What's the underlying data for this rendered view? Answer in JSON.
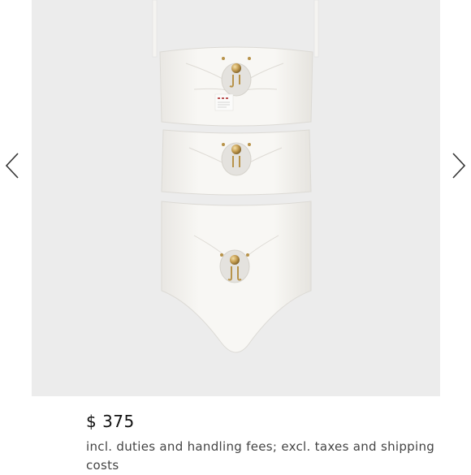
{
  "carousel": {
    "prev_icon": "chevron-left-icon",
    "next_icon": "chevron-right-icon",
    "image_alt": "white one-piece swimsuit with gold hardware cut-outs"
  },
  "product": {
    "price": "$ 375",
    "price_note": "incl. duties and handling fees; excl. taxes and shipping costs"
  },
  "colors": {
    "image_background": "#ececec",
    "swimsuit": "#f7f6f3",
    "hardware_gold": "#b8934a",
    "arrow": "#333333"
  }
}
